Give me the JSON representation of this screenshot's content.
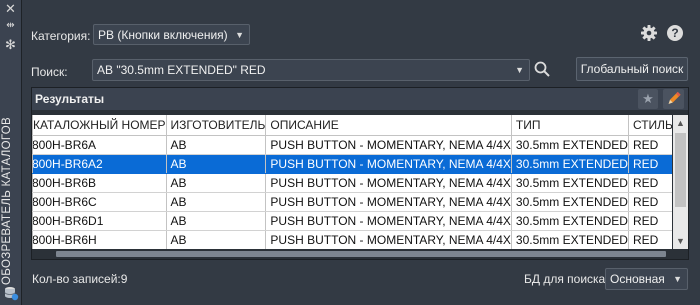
{
  "sidebar": {
    "title": "ОБОЗРЕВАТЕЛЬ КАТАЛОГОВ",
    "close_icon": "close-icon",
    "pin_icon": "pin-icon",
    "settings_icon": "gear-icon",
    "db_icon": "database-icon"
  },
  "category": {
    "label": "Категория:",
    "value": "PB (Кнопки включения)"
  },
  "search": {
    "label": "Поиск:",
    "value": "AB \"30.5mm EXTENDED\" RED",
    "global_button": "Глобальный поиск"
  },
  "results": {
    "title": "Результаты",
    "columns": [
      "КАТАЛОЖНЫЙ НОМЕР",
      "ИЗГОТОВИТЕЛЬ",
      "ОПИСАНИЕ",
      "ТИП",
      "СТИЛЬ"
    ],
    "rows": [
      [
        "800H-BR6A",
        "AB",
        "PUSH BUTTON - MOMENTARY, NEMA 4/4X",
        "30.5mm EXTENDED",
        "RED"
      ],
      [
        "800H-BR6A2",
        "AB",
        "PUSH BUTTON - MOMENTARY, NEMA 4/4X",
        "30.5mm EXTENDED",
        "RED"
      ],
      [
        "800H-BR6B",
        "AB",
        "PUSH BUTTON - MOMENTARY, NEMA 4/4X",
        "30.5mm EXTENDED",
        "RED"
      ],
      [
        "800H-BR6C",
        "AB",
        "PUSH BUTTON - MOMENTARY, NEMA 4/4X",
        "30.5mm EXTENDED",
        "RED"
      ],
      [
        "800H-BR6D1",
        "AB",
        "PUSH BUTTON - MOMENTARY, NEMA 4/4X",
        "30.5mm EXTENDED",
        "RED"
      ],
      [
        "800H-BR6H",
        "AB",
        "PUSH BUTTON - MOMENTARY, NEMA 4/4X",
        "30.5mm EXTENDED",
        "RED"
      ]
    ],
    "selected_row": 1
  },
  "footer": {
    "count": "Кол-во записей:9",
    "db_label": "БД для поиска:",
    "db_value": "Основная"
  },
  "colors": {
    "selection": "#0a6bd6",
    "panel": "#333a44"
  }
}
